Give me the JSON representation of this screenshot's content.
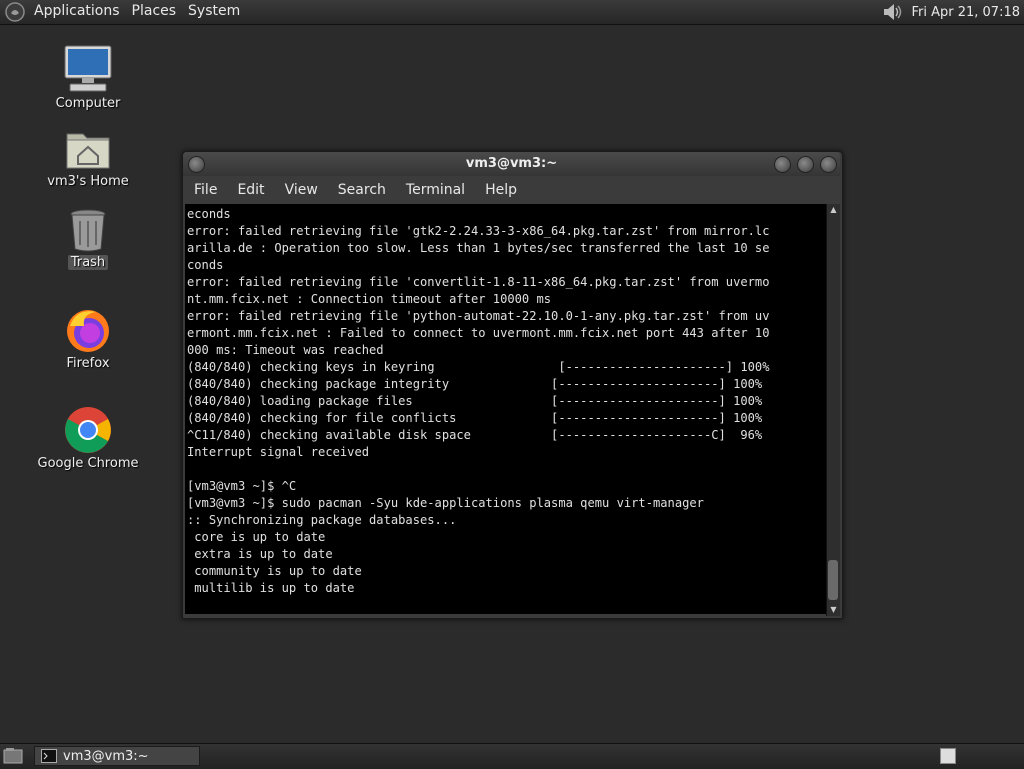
{
  "top_panel": {
    "menus": [
      "Applications",
      "Places",
      "System"
    ],
    "clock": "Fri Apr 21, 07:18"
  },
  "desktop": {
    "icons": [
      {
        "label": "Computer",
        "icon": "computer-icon"
      },
      {
        "label": "vm3's Home",
        "icon": "home-folder-icon"
      },
      {
        "label": "Trash",
        "icon": "trash-icon"
      },
      {
        "label": "Firefox",
        "icon": "firefox-icon"
      },
      {
        "label": "Google Chrome",
        "icon": "chrome-icon"
      }
    ]
  },
  "terminal": {
    "title": "vm3@vm3:~",
    "menu": [
      "File",
      "Edit",
      "View",
      "Search",
      "Terminal",
      "Help"
    ],
    "lines": [
      "econds",
      "error: failed retrieving file 'gtk2-2.24.33-3-x86_64.pkg.tar.zst' from mirror.lc",
      "arilla.de : Operation too slow. Less than 1 bytes/sec transferred the last 10 se",
      "conds",
      "error: failed retrieving file 'convertlit-1.8-11-x86_64.pkg.tar.zst' from uvermo",
      "nt.mm.fcix.net : Connection timeout after 10000 ms",
      "error: failed retrieving file 'python-automat-22.10.0-1-any.pkg.tar.zst' from uv",
      "ermont.mm.fcix.net : Failed to connect to uvermont.mm.fcix.net port 443 after 10",
      "000 ms: Timeout was reached",
      "(840/840) checking keys in keyring                 [----------------------] 100%",
      "(840/840) checking package integrity              [----------------------] 100%",
      "(840/840) loading package files                   [----------------------] 100%",
      "(840/840) checking for file conflicts             [----------------------] 100%",
      "^C11/840) checking available disk space           [---------------------C]  96%",
      "Interrupt signal received",
      "",
      "[vm3@vm3 ~]$ ^C",
      "[vm3@vm3 ~]$ sudo pacman -Syu kde-applications plasma qemu virt-manager",
      ":: Synchronizing package databases...",
      " core is up to date",
      " extra is up to date",
      " community is up to date",
      " multilib is up to date"
    ]
  },
  "taskbar": {
    "window_button": "vm3@vm3:~"
  }
}
